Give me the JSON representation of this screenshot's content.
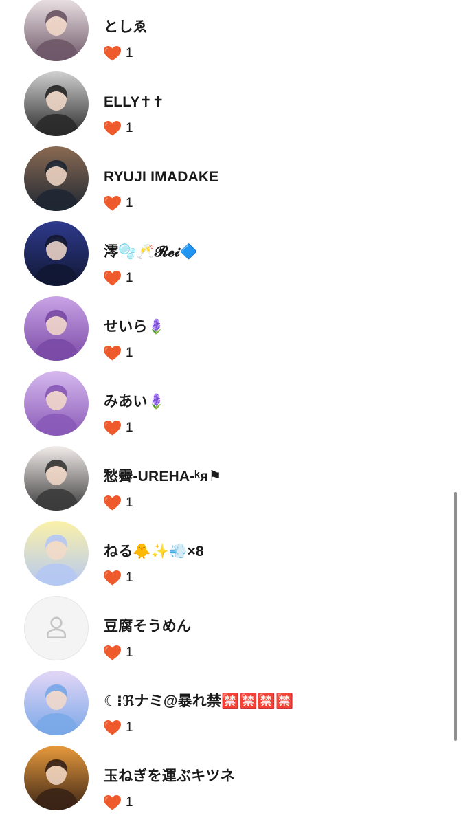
{
  "heart_color": "#ef5a2c",
  "items": [
    {
      "name": "としゑ",
      "likes": "1",
      "avatar_colors": [
        "#efe6e8",
        "#6e5868"
      ],
      "avatar_icon": "photo-avatar"
    },
    {
      "name": "ELLY✝✝",
      "likes": "1",
      "avatar_colors": [
        "#cfcfcf",
        "#2a2a2a"
      ],
      "avatar_icon": "photo-avatar"
    },
    {
      "name": "RYUJI IMADAKE",
      "likes": "1",
      "avatar_colors": [
        "#8a6a52",
        "#1f2733"
      ],
      "avatar_icon": "photo-avatar"
    },
    {
      "name": "澪🫧🥂𝓡𝓮𝓲🔷",
      "likes": "1",
      "avatar_colors": [
        "#2e3a8c",
        "#111733"
      ],
      "avatar_icon": "illustration-avatar"
    },
    {
      "name": "せいら🪻",
      "likes": "1",
      "avatar_colors": [
        "#c9a3e6",
        "#7a4aa6"
      ],
      "avatar_icon": "illustration-avatar"
    },
    {
      "name": "みあい🪻",
      "likes": "1",
      "avatar_colors": [
        "#d6b9ee",
        "#8a5ab8"
      ],
      "avatar_icon": "illustration-avatar"
    },
    {
      "name": "愁霽-UREHA-ᵏᴙ⚑",
      "likes": "1",
      "avatar_colors": [
        "#f2ecea",
        "#3b3b3b"
      ],
      "avatar_icon": "illustration-avatar"
    },
    {
      "name": "ねる🐥✨💨×8",
      "likes": "1",
      "avatar_colors": [
        "#fbf1a8",
        "#b5c8f2"
      ],
      "avatar_icon": "illustration-avatar"
    },
    {
      "name": "豆腐そうめん",
      "likes": "1",
      "avatar_colors": [
        "#f4f4f4",
        "#c4c4c4"
      ],
      "avatar_icon": "default-user-icon"
    },
    {
      "name": "☾⁝ℜナミ@暴れ禁🈲🈲🈲🈲",
      "likes": "1",
      "avatar_colors": [
        "#e3d6f6",
        "#7aa8e8"
      ],
      "avatar_icon": "illustration-avatar"
    },
    {
      "name": "玉ねぎを運ぶキツネ",
      "likes": "1",
      "avatar_colors": [
        "#e89a3c",
        "#3a2416"
      ],
      "avatar_icon": "illustration-avatar"
    }
  ]
}
